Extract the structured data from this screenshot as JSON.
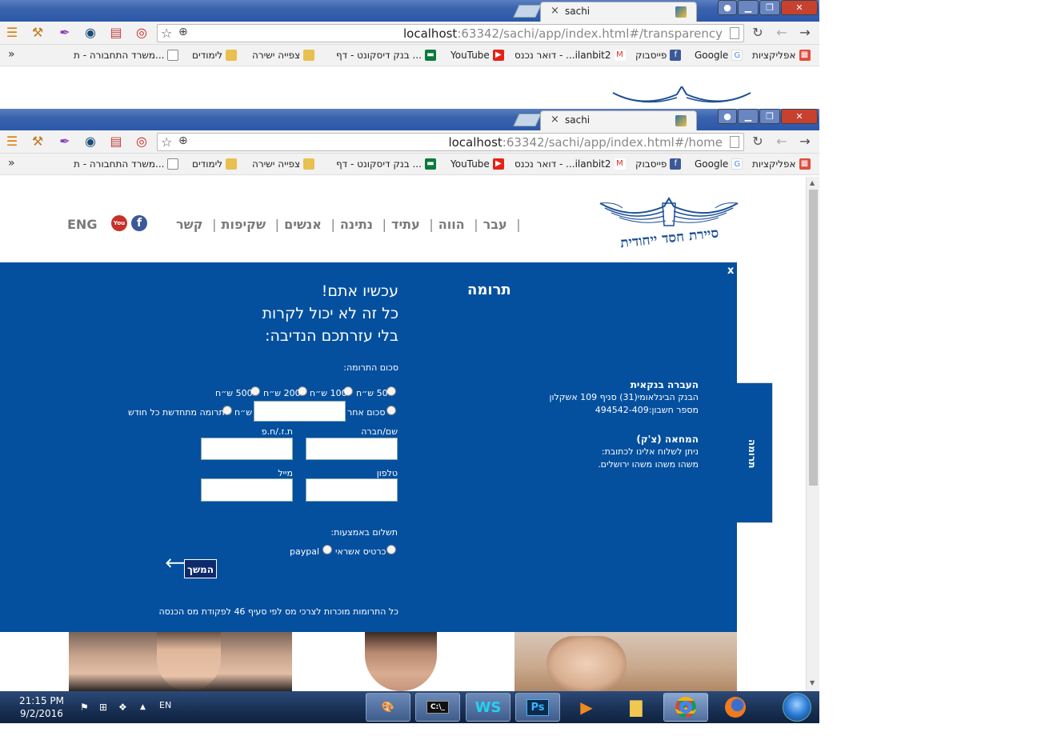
{
  "browser_back": {
    "tab_title": "sachi",
    "url_host": "localhost",
    "url_rest": ":63342/sachi/app/index.html#/transparency"
  },
  "browser_front": {
    "tab_title": "sachi",
    "url_host": "localhost",
    "url_rest": ":63342/sachi/app/index.html#/home"
  },
  "bookmarks": [
    {
      "label": "אפליקציות",
      "icon": "apps-grid-icon",
      "color": "#e04c3c"
    },
    {
      "label": "Google",
      "icon": "google-icon",
      "color": "#4285f4"
    },
    {
      "label": "פייסבוק",
      "icon": "facebook-icon",
      "color": "#3b5998"
    },
    {
      "label": "דואר נכנס - ...ilanbit2",
      "icon": "gmail-icon",
      "color": "#d93025"
    },
    {
      "label": "YouTube",
      "icon": "youtube-icon",
      "color": "#e62117"
    },
    {
      "label": "בנק דיסקונט - דף ...",
      "icon": "bank-icon",
      "color": "#0a7a3a"
    },
    {
      "label": "צפייה ישירה",
      "icon": "folder-icon",
      "color": "#e8c050"
    },
    {
      "label": "לימודים",
      "icon": "folder-icon",
      "color": "#e8c050"
    },
    {
      "label": "משרד התחבורה - ת...",
      "icon": "page-icon",
      "color": "#888888"
    }
  ],
  "site": {
    "logo_text": "סיירת חסד ייחודית",
    "nav": [
      "עבר",
      "הווה",
      "עתיד",
      "נתינה",
      "אנשים",
      "שקיפות",
      "קשר"
    ],
    "lang": "ENG"
  },
  "donation": {
    "close_label": "x",
    "title": "תרומה",
    "headline": [
      "עכשיו אתם!",
      "כל זה לא יכול לקרות",
      "בלי עזרתכם הנדיבה:"
    ],
    "amount_label": "סכום התרומה:",
    "amounts": [
      "50 ש״ח",
      "100 ש״ח",
      "200 ש״ח",
      "500 ש״ח"
    ],
    "other_amount": "סכום אחר",
    "currency": "ש״ח",
    "monthly": "תרומה מתחדשת כל חודש",
    "name_label": "שם/חברה",
    "id_label": "ת.ז./ח.פ",
    "phone_label": "טלפון",
    "email_label": "מייל",
    "payment_label": "תשלום באמצעות:",
    "payment_options": [
      "כרטיס אשראי",
      "paypal"
    ],
    "continue_label": "המשך",
    "footnote": "כל התרומות מוכרות לצרכי מס לפי סעיף 46 לפקודת מס הכנסה",
    "bank_title": "העברה בנקאית",
    "bank_line1": "הבנק הבינלאומי(31) סניף 109 אשקלון",
    "bank_line2": "מספר חשבון:494542-409",
    "cheque_title": "המחאה (צ'ק)",
    "cheque_line1": "ניתן לשלוח אלינו לכתובת:",
    "cheque_line2": "משהו משהו משהו ירושלים.",
    "side_tab": "תרומה"
  },
  "taskbar": {
    "time": "21:15 PM",
    "date": "9/2/2016",
    "lang": "EN",
    "apps": [
      "paint",
      "cmd",
      "webstorm",
      "photoshop",
      "media-player",
      "file-explorer",
      "chrome",
      "firefox"
    ]
  }
}
